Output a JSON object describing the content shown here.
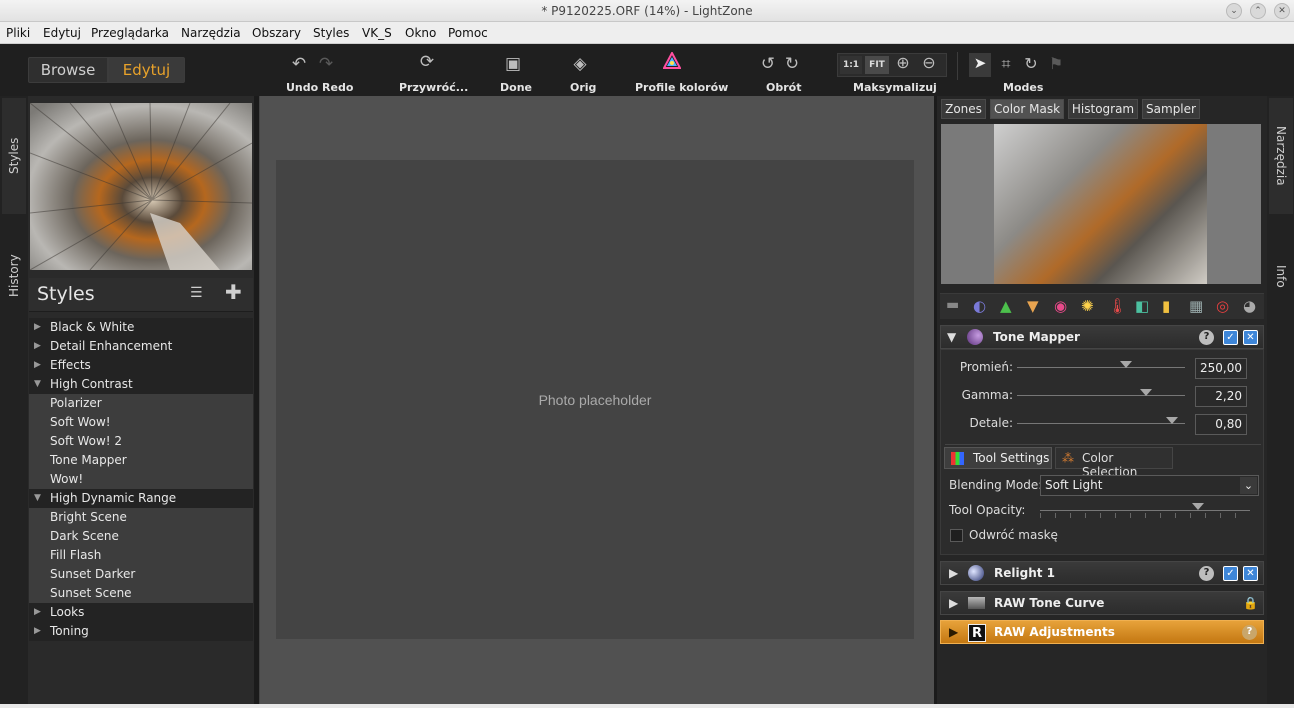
{
  "window": {
    "title": "* P9120225.ORF (14%) - LightZone"
  },
  "menu": [
    "Pliki",
    "Edytuj",
    "Przeglądarka",
    "Narzędzia",
    "Obszary",
    "Styles",
    "VK_S",
    "Okno",
    "Pomoc"
  ],
  "toolbar": {
    "browse": "Browse",
    "edit": "Edytuj",
    "undo_redo": "Undo Redo",
    "restore": "Przywróć...",
    "done": "Done",
    "orig": "Orig",
    "color_profiles": "Profile kolorów",
    "rotate": "Obrót",
    "zoom_1_1": "1:1",
    "zoom_fit": "FIT",
    "maximize": "Maksymalizuj",
    "modes": "Modes"
  },
  "left_rail": {
    "styles_tab": "Styles",
    "history_tab": "History"
  },
  "styles_panel": {
    "title": "Styles",
    "rows": [
      {
        "label": "Black & White",
        "type": "group"
      },
      {
        "label": "Detail Enhancement",
        "type": "group"
      },
      {
        "label": "Effects",
        "type": "group"
      },
      {
        "label": "High Contrast",
        "type": "group-open"
      },
      {
        "label": "Polarizer",
        "type": "item"
      },
      {
        "label": "Soft Wow!",
        "type": "item"
      },
      {
        "label": "Soft Wow! 2",
        "type": "item"
      },
      {
        "label": "Tone Mapper",
        "type": "item"
      },
      {
        "label": "Wow!",
        "type": "item"
      },
      {
        "label": "High Dynamic Range",
        "type": "group-open"
      },
      {
        "label": "Bright Scene",
        "type": "item"
      },
      {
        "label": "Dark Scene",
        "type": "item"
      },
      {
        "label": "Fill Flash",
        "type": "item"
      },
      {
        "label": "Sunset Darker",
        "type": "item"
      },
      {
        "label": "Sunset Scene",
        "type": "item"
      },
      {
        "label": "Looks",
        "type": "group"
      },
      {
        "label": "Toning",
        "type": "group"
      }
    ]
  },
  "right_tabs": [
    {
      "label": "Zones",
      "selected": false
    },
    {
      "label": "Color Mask",
      "selected": true
    },
    {
      "label": "Histogram",
      "selected": false
    },
    {
      "label": "Sampler",
      "selected": false
    }
  ],
  "right_rail": {
    "tools_tab": "Narzędzia",
    "info_tab": "Info"
  },
  "tone_mapper": {
    "title": "Tone Mapper",
    "sliders": [
      {
        "label": "Promień:",
        "value": "250,00",
        "pos": 0.65
      },
      {
        "label": "Gamma:",
        "value": "2,20",
        "pos": 0.77
      },
      {
        "label": "Detale:",
        "value": "0,80",
        "pos": 0.92
      }
    ],
    "subtabs": {
      "settings": "Tool Settings",
      "color_selection": "Color Selection"
    },
    "blending_label": "Blending Mode:",
    "blending_value": "Soft Light",
    "opacity_label": "Tool Opacity:",
    "opacity_pos": 0.75,
    "invert_mask": "Odwróć maskę"
  },
  "tools": [
    {
      "title": "Relight 1"
    },
    {
      "title": "RAW Tone Curve"
    },
    {
      "title": "RAW Adjustments"
    }
  ],
  "colors": {
    "accent": "#e8a22a",
    "raw_highlight": "#c87a10"
  }
}
